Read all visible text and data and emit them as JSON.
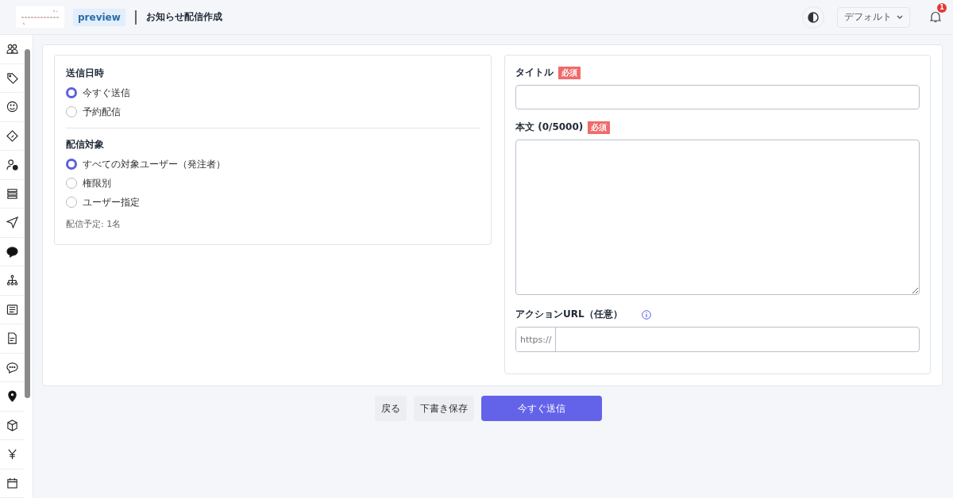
{
  "header": {
    "env_badge": "preview",
    "page_title": "お知らせ配信作成",
    "theme_select": "デフォルト",
    "notification_count": "1"
  },
  "schedule": {
    "heading": "送信日時",
    "options": [
      {
        "label": "今すぐ送信",
        "selected": true
      },
      {
        "label": "予約配信",
        "selected": false
      }
    ]
  },
  "target": {
    "heading": "配信対象",
    "options": [
      {
        "label": "すべての対象ユーザー（発注者）",
        "selected": true
      },
      {
        "label": "権限別",
        "selected": false
      },
      {
        "label": "ユーザー指定",
        "selected": false
      }
    ],
    "note": "配信予定: 1名"
  },
  "form": {
    "title_label": "タイトル",
    "title_badge": "必須",
    "body_label": "本文 (0/5000)",
    "body_badge": "必須",
    "url_label": "アクションURL（任意）",
    "url_prefix": "https://"
  },
  "buttons": [
    {
      "label": "戻る",
      "kind": "secondary"
    },
    {
      "label": "下書き保存",
      "kind": "secondary"
    },
    {
      "label": "今すぐ送信",
      "kind": "primary"
    }
  ]
}
